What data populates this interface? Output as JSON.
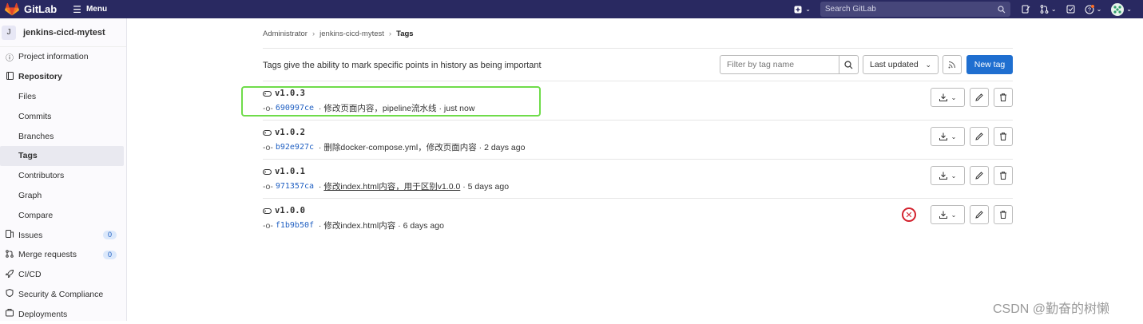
{
  "topbar": {
    "brand": "GitLab",
    "menu_label": "Menu",
    "search_placeholder": "Search GitLab"
  },
  "sidebar": {
    "project_avatar": "J",
    "project_name": "jenkins-cicd-mytest",
    "items": [
      {
        "label": "Project information",
        "icon": "info-icon"
      },
      {
        "label": "Repository",
        "icon": "book-icon"
      },
      {
        "label": "Files"
      },
      {
        "label": "Commits"
      },
      {
        "label": "Branches"
      },
      {
        "label": "Tags"
      },
      {
        "label": "Contributors"
      },
      {
        "label": "Graph"
      },
      {
        "label": "Compare"
      },
      {
        "label": "Issues",
        "icon": "issues-icon",
        "badge": "0"
      },
      {
        "label": "Merge requests",
        "icon": "merge-request-icon",
        "badge": "0"
      },
      {
        "label": "CI/CD",
        "icon": "rocket-icon"
      },
      {
        "label": "Security & Compliance",
        "icon": "shield-icon"
      },
      {
        "label": "Deployments",
        "icon": "deployments-icon"
      }
    ]
  },
  "breadcrumb": [
    "Administrator",
    "jenkins-cicd-mytest",
    "Tags"
  ],
  "main": {
    "description": "Tags give the ability to mark specific points in history as being important",
    "filter_placeholder": "Filter by tag name",
    "sort_label": "Last updated",
    "new_tag_label": "New tag"
  },
  "tags": [
    {
      "name": "v1.0.3",
      "sha": "690997ce",
      "message": "修改页面内容，pipeline流水线",
      "time": "just now"
    },
    {
      "name": "v1.0.2",
      "sha": "b92e927c",
      "message": "删除docker-compose.yml，修改页面内容",
      "time": "2 days ago"
    },
    {
      "name": "v1.0.1",
      "sha": "971357ca",
      "message": "修改index.html内容，用于区别v1.0.0",
      "time": "5 days ago"
    },
    {
      "name": "v1.0.0",
      "sha": "f1b9b50f",
      "message": "修改index.html内容",
      "time": "6 days ago"
    }
  ],
  "watermark": "CSDN @勤奋的树懒",
  "colors": {
    "topbar": "#292961",
    "accent": "#1f6fd0",
    "highlight": "#6fdc4a",
    "failed": "#d3222e"
  }
}
